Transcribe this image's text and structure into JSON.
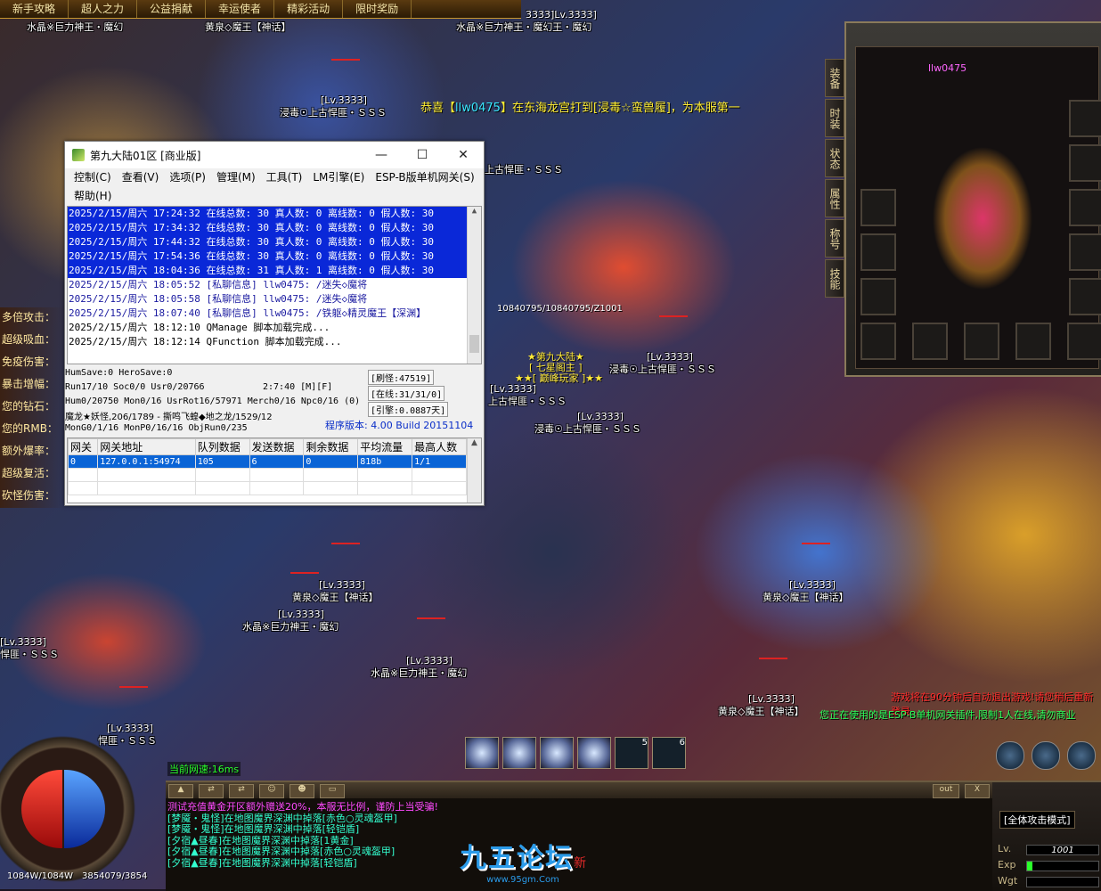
{
  "topbar": {
    "tabs": [
      "新手攻略",
      "超人之力",
      "公益捐献",
      "幸运使者",
      "精彩活动",
      "限时奖励"
    ]
  },
  "broadcast": {
    "prefix": "恭喜【",
    "player": "llw0475",
    "middle": "】在东海龙宫打到[",
    "item": "浸毒☆蛮兽履",
    "suffix": "]，为本服第一"
  },
  "overhead": {
    "lv": "[Lv.3333]",
    "n_shuijing": "水晶※巨力神王・魔幻",
    "n_shuijing2": "水晶※巨力神王・魔幻王・魔幻",
    "n_huangquan": "黄泉◇魔王【神话】",
    "n_jindu": "浸毒☉上古悍匪・ＳＳＳ",
    "n_shanggu": "上古悍匪・ＳＳＳ",
    "n_pisu": "悍匪・ＳＳＳ",
    "n_lv_top": "3333]Lv.3333]",
    "hp_ratio": "10840795/10840795/Z1001",
    "guild_1": "★第九大陆★",
    "guild_2": "[ 七星阁主 ]",
    "guild_3": "★★[ 巅峰玩家 ]★★"
  },
  "leftpanel": {
    "rows": [
      "多倍攻击：",
      "超级吸血：",
      "免疫伤害：",
      "暴击增幅：",
      "您的钻石：",
      "您的RMB：",
      "额外爆率：",
      "超级复活：",
      "砍怪伤害："
    ]
  },
  "server_window": {
    "title": "第九大陆01区 [商业版]",
    "minimize": "—",
    "maximize": "☐",
    "close": "✕",
    "menu": [
      "控制(C)",
      "查看(V)",
      "选项(P)",
      "管理(M)",
      "工具(T)",
      "LM引擎(E)",
      "ESP-B版单机网关(S)",
      "帮助(H)"
    ],
    "log": [
      "2025/2/15/周六 17:24:32 在线总数: 30 真人数: 0 离线数: 0 假人数: 30",
      "2025/2/15/周六 17:34:32 在线总数: 30 真人数: 0 离线数: 0 假人数: 30",
      "2025/2/15/周六 17:44:32 在线总数: 30 真人数: 0 离线数: 0 假人数: 30",
      "2025/2/15/周六 17:54:36 在线总数: 30 真人数: 0 离线数: 0 假人数: 30",
      "2025/2/15/周六 18:04:36 在线总数: 31 真人数: 1 离线数: 0 假人数: 30",
      "2025/2/15/周六 18:05:52 [私聊信息] llw0475: /迷失◇魔将",
      "2025/2/15/周六 18:05:58 [私聊信息] llw0475: /迷失◇魔将",
      "2025/2/15/周六 18:07:40 [私聊信息] llw0475: /铁躯◇精灵魔王【深渊】",
      "2025/2/15/周六 18:12:10 QManage 脚本加载完成...",
      "2025/2/15/周六 18:12:14 QFunction 脚本加载完成..."
    ],
    "stats": {
      "line1": "HumSave:0 HeroSave:0",
      "line2": "Run17/10 Soc0/0 Usr0/20766",
      "time": "2:7:40 [M][F]",
      "line3": "Hum0/20750 Mon0/16 UsrRot16/57971 Merch0/16 Npc0/16 (0)",
      "line4": "魔龙★妖怪,206/1789 - 撕鸣飞蝗◆地之龙/1529/12",
      "line5": "MonG0/1/16 MonP0/16/16 ObjRun0/235",
      "refresh": "[刷怪:47519]",
      "online": "[在线:31/31/0]",
      "engine": "[引擎:0.0887天]",
      "version": "程序版本: 4.00 Build 20151104"
    },
    "grid": {
      "headers": [
        "网关",
        "网关地址",
        "队列数据",
        "发送数据",
        "剩余数据",
        "平均流量",
        "最高人数"
      ],
      "rows": [
        [
          "0",
          "127.0.0.1:54974",
          "105",
          "6",
          "0",
          "818b",
          "1/1"
        ]
      ]
    }
  },
  "equip": {
    "player_name": "llw0475",
    "tabs": [
      "装备",
      "时装",
      "状态",
      "属性",
      "称号",
      "技能"
    ]
  },
  "hud": {
    "net_speed": "当前网速:16ms",
    "hp_mp": "1084W/1084W",
    "exp": "3854079/3854",
    "chat_out": "out",
    "chat_close": "X",
    "chat": [
      "测试充值黄金开区额外赠送20%，本服无比例，谨防上当受骗!",
      "[梦魇・鬼怪]在地图魔界深渊中掉落[赤色○灵魂盔甲]",
      "[梦魇・鬼怪]在地图魔界深渊中掉落[轻铠盾]",
      "[夕宿▲昼春]在地图魔界深渊中掉落[1黄金]",
      "[夕宿▲昼春]在地图魔界深渊中掉落[赤色○灵魂盔甲]",
      "[夕宿▲昼春]在地图魔界深渊中掉落[轻铠盾]"
    ],
    "watermark": "九五论坛",
    "watermark_url": "www.95gm.Com",
    "watermark_badge": "新",
    "skill_keys": [
      "5",
      "6"
    ],
    "attack_mode": "[全体攻击模式]",
    "lv_label": "Lv.",
    "lv_value": "1001",
    "exp_label": "Exp",
    "wgt_label": "Wgt",
    "warn1": "游戏将在90分钟后自动退出游戏!请您稍后重新登录",
    "warn2": "您正在使用的是ESP-B单机网关插件,限制1人在线,请勿商业"
  }
}
